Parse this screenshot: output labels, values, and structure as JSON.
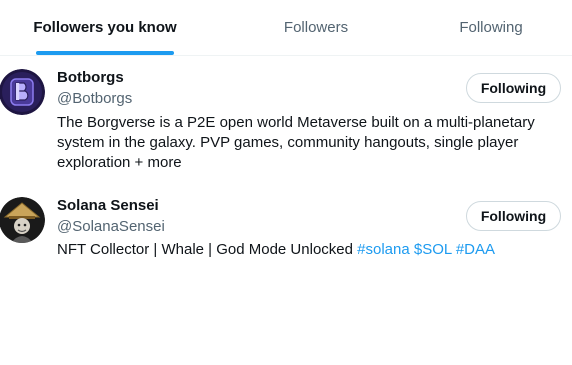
{
  "tabs": [
    {
      "label": "Followers you know",
      "active": true
    },
    {
      "label": "Followers",
      "active": false
    },
    {
      "label": "Following",
      "active": false
    }
  ],
  "users": [
    {
      "name": "Botborgs",
      "handle": "@Botborgs",
      "bio_lines": [
        "The Borgverse is a P2E open world Metaverse built on a multi-planetary",
        "system in the galaxy. PVP games, community hangouts, single player",
        "exploration + more"
      ],
      "button_label": "Following",
      "avatar_icon": "botborgs-logo-icon"
    },
    {
      "name": "Solana Sensei",
      "handle": "@SolanaSensei",
      "bio_text": "NFT Collector | Whale | God Mode Unlocked ",
      "bio_links": [
        "#solana",
        "$SOL",
        "#DAA"
      ],
      "button_label": "Following",
      "avatar_icon": "sensei-avatar-icon"
    }
  ],
  "colors": {
    "accent": "#1d9bf0",
    "text": "#0f1419",
    "secondary_text": "#536471",
    "border": "#cfd9de"
  }
}
